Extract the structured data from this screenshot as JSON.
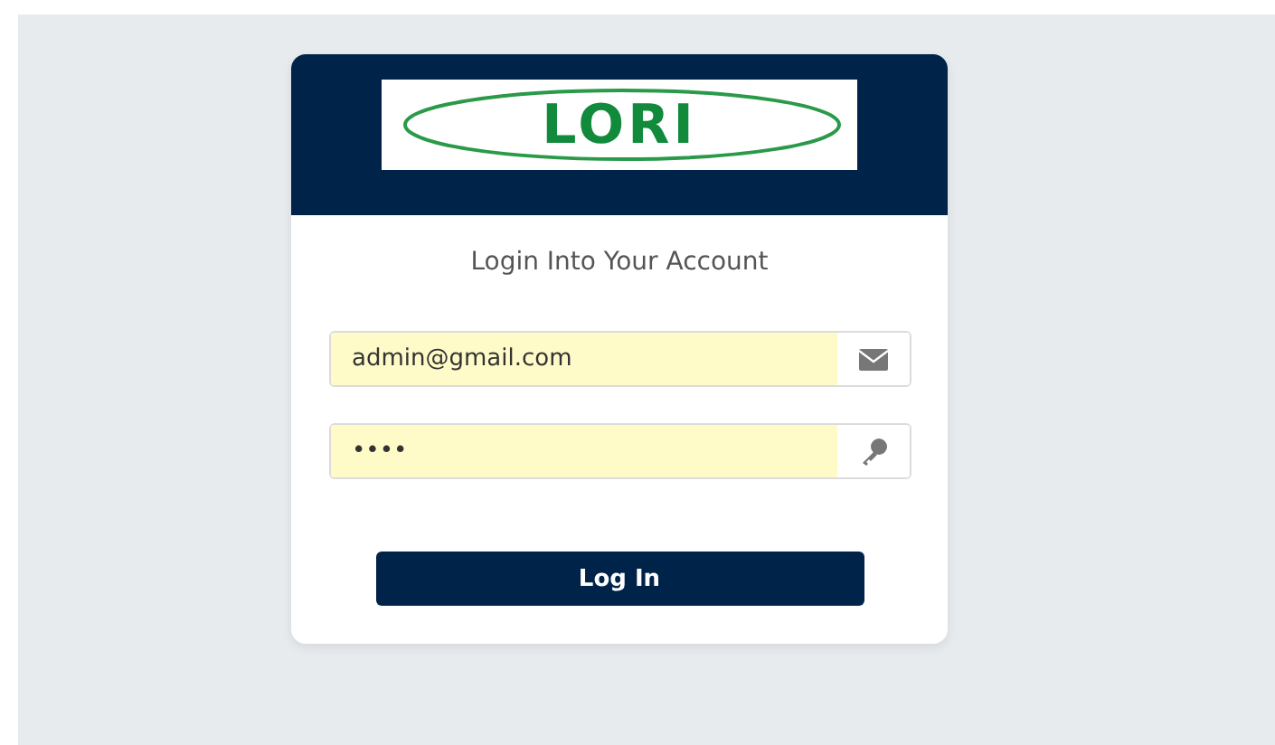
{
  "logo": {
    "text": "LORI"
  },
  "title": "Login Into Your Account",
  "fields": [
    {
      "kind": "email",
      "value": "admin@gmail.com"
    },
    {
      "kind": "password",
      "value": "••••"
    }
  ],
  "submit": {
    "label": "Log In"
  }
}
